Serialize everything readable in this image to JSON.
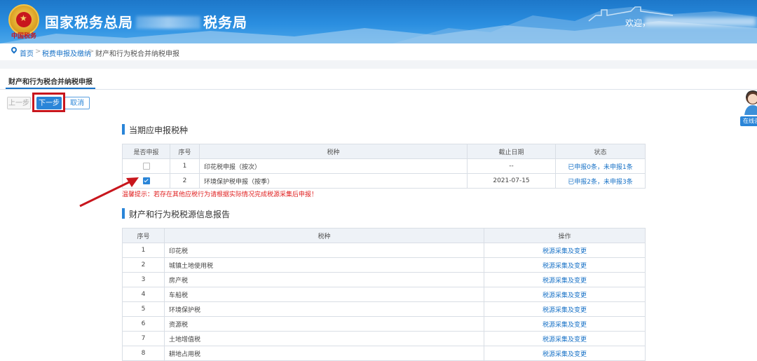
{
  "header": {
    "title_left": "国家税务总局",
    "title_right": "税务局",
    "motto": "中国税务",
    "welcome": "欢迎，"
  },
  "breadcrumb": {
    "home": "首页",
    "item1": "税费申报及缴纳",
    "current": "财产和行为税合并纳税申报",
    "sep": ">"
  },
  "tab": {
    "label": "财产和行为税合并纳税申报"
  },
  "buttons": {
    "prev": "上一步",
    "next": "下一步",
    "cancel": "取消"
  },
  "section1": {
    "title": "当期应申报税种",
    "headers": [
      "是否申报",
      "序号",
      "税种",
      "截止日期",
      "状态"
    ],
    "rows": [
      {
        "checked": false,
        "no": "1",
        "tax": "印花税申报（按次）",
        "deadline": "--",
        "status": "已申报0条，未申报1条"
      },
      {
        "checked": true,
        "no": "2",
        "tax": "环境保护税申报（按季）",
        "deadline": "2021-07-15",
        "status": "已申报2条，未申报3条"
      }
    ],
    "tip": "温馨提示：若存在其他应税行为请根据实际情况完成税源采集后申报！"
  },
  "section2": {
    "title": "财产和行为税税源信息报告",
    "headers": [
      "序号",
      "税种",
      "操作"
    ],
    "rows": [
      {
        "no": "1",
        "tax": "印花税",
        "op": "税源采集及变更"
      },
      {
        "no": "2",
        "tax": "城镇土地使用税",
        "op": "税源采集及变更"
      },
      {
        "no": "3",
        "tax": "房产税",
        "op": "税源采集及变更"
      },
      {
        "no": "4",
        "tax": "车船税",
        "op": "税源采集及变更"
      },
      {
        "no": "5",
        "tax": "环境保护税",
        "op": "税源采集及变更"
      },
      {
        "no": "6",
        "tax": "资源税",
        "op": "税源采集及变更"
      },
      {
        "no": "7",
        "tax": "土地增值税",
        "op": "税源采集及变更"
      },
      {
        "no": "8",
        "tax": "耕地占用税",
        "op": "税源采集及变更"
      }
    ]
  },
  "online_service": {
    "label": "在线咨"
  },
  "colors": {
    "accent": "#2a85d8",
    "highlight": "#c8161d",
    "header_bg": "#1d77c9",
    "tip": "#e02020"
  }
}
